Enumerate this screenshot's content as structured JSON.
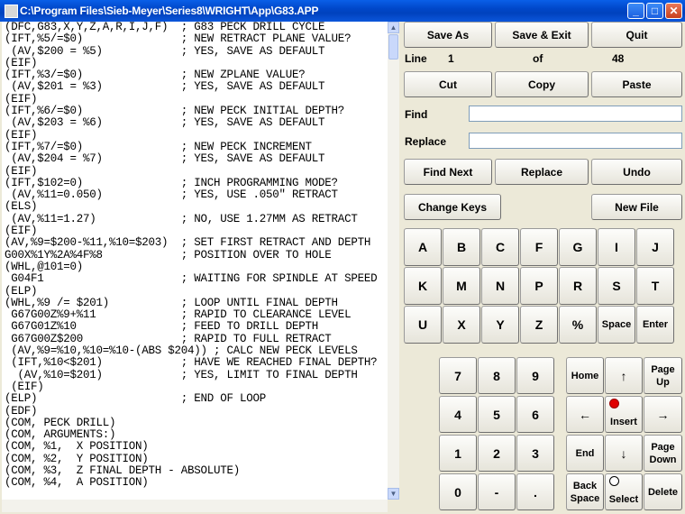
{
  "window": {
    "title": "C:\\Program Files\\Sieb-Meyer\\Series8\\WRIGHT\\App\\G83.APP",
    "minimize_icon": "minimize-icon",
    "maximize_icon": "maximize-icon",
    "close_icon": "close-icon"
  },
  "editor": {
    "lines": [
      "(DFC,G83,X,Y,Z,A,R,I,J,F)  ; G83 PECK DRILL CYCLE",
      "(IFT,%5/=$0)               ; NEW RETRACT PLANE VALUE?",
      " (AV,$200 = %5)            ; YES, SAVE AS DEFAULT",
      "(EIF)",
      "(IFT,%3/=$0)               ; NEW ZPLANE VALUE?",
      " (AV,$201 = %3)            ; YES, SAVE AS DEFAULT",
      "(EIF)",
      "(IFT,%6/=$0)               ; NEW PECK INITIAL DEPTH?",
      " (AV,$203 = %6)            ; YES, SAVE AS DEFAULT",
      "(EIF)",
      "(IFT,%7/=$0)               ; NEW PECK INCREMENT",
      " (AV,$204 = %7)            ; YES, SAVE AS DEFAULT",
      "(EIF)",
      "(IFT,$102=0)               ; INCH PROGRAMMING MODE?",
      " (AV,%11=0.050)            ; YES, USE .050\" RETRACT",
      "(ELS)",
      " (AV,%11=1.27)             ; NO, USE 1.27MM AS RETRACT",
      "(EIF)",
      "(AV,%9=$200-%11,%10=$203)  ; SET FIRST RETRACT AND DEPTH",
      "G00X%1Y%2A%4F%8            ; POSITION OVER TO HOLE",
      "(WHL,@101=0)",
      " G04F1                     ; WAITING FOR SPINDLE AT SPEED",
      "(ELP)",
      "(WHL,%9 /= $201)           ; LOOP UNTIL FINAL DEPTH",
      " G67G00Z%9+%11             ; RAPID TO CLEARANCE LEVEL",
      " G67G01Z%10                ; FEED TO DRILL DEPTH",
      " G67G00Z$200               ; RAPID TO FULL RETRACT",
      " (AV,%9=%10,%10=%10-(ABS $204)) ; CALC NEW PECK LEVELS",
      " (IFT,%10<$201)            ; HAVE WE REACHED FINAL DEPTH?",
      "  (AV,%10=$201)            ; YES, LIMIT TO FINAL DEPTH",
      " (EIF)",
      "(ELP)                      ; END OF LOOP",
      "(EDF)",
      "(COM, PECK DRILL)",
      "(COM, ARGUMENTS:)",
      "(COM, %1,  X POSITION)",
      "(COM, %2,  Y POSITION)",
      "(COM, %3,  Z FINAL DEPTH - ABSOLUTE)",
      "(COM, %4,  A POSITION)"
    ]
  },
  "toolbar": {
    "save_as": "Save As",
    "save_exit": "Save & Exit",
    "quit": "Quit",
    "cut": "Cut",
    "copy": "Copy",
    "paste": "Paste",
    "find_next": "Find Next",
    "replace": "Replace",
    "undo": "Undo",
    "change_keys": "Change Keys",
    "new_file": "New File"
  },
  "status": {
    "line_label": "Line",
    "line_value": "1",
    "of_label": "of",
    "total_value": "48"
  },
  "search": {
    "find_label": "Find",
    "find_value": "",
    "replace_label": "Replace",
    "replace_value": ""
  },
  "letters": {
    "row1": [
      "A",
      "B",
      "C",
      "F",
      "G",
      "I",
      "J"
    ],
    "row2": [
      "K",
      "M",
      "N",
      "P",
      "R",
      "S",
      "T"
    ],
    "row3": [
      "U",
      "X",
      "Y",
      "Z",
      "%",
      "Space",
      "Enter"
    ]
  },
  "numpad": {
    "row1": [
      "7",
      "8",
      "9"
    ],
    "row2": [
      "4",
      "5",
      "6"
    ],
    "row3": [
      "1",
      "2",
      "3"
    ],
    "row4": [
      "0",
      "-",
      "."
    ]
  },
  "nav": {
    "home": "Home",
    "page_up": "Page Up",
    "insert": "Insert",
    "end": "End",
    "page_down": "Page Down",
    "back_space": "Back Space",
    "select": "Select",
    "delete": "Delete",
    "up_arrow": "↑",
    "down_arrow": "↓",
    "left_arrow": "←",
    "right_arrow": "→",
    "insert_indicator_color": "#e00000"
  }
}
